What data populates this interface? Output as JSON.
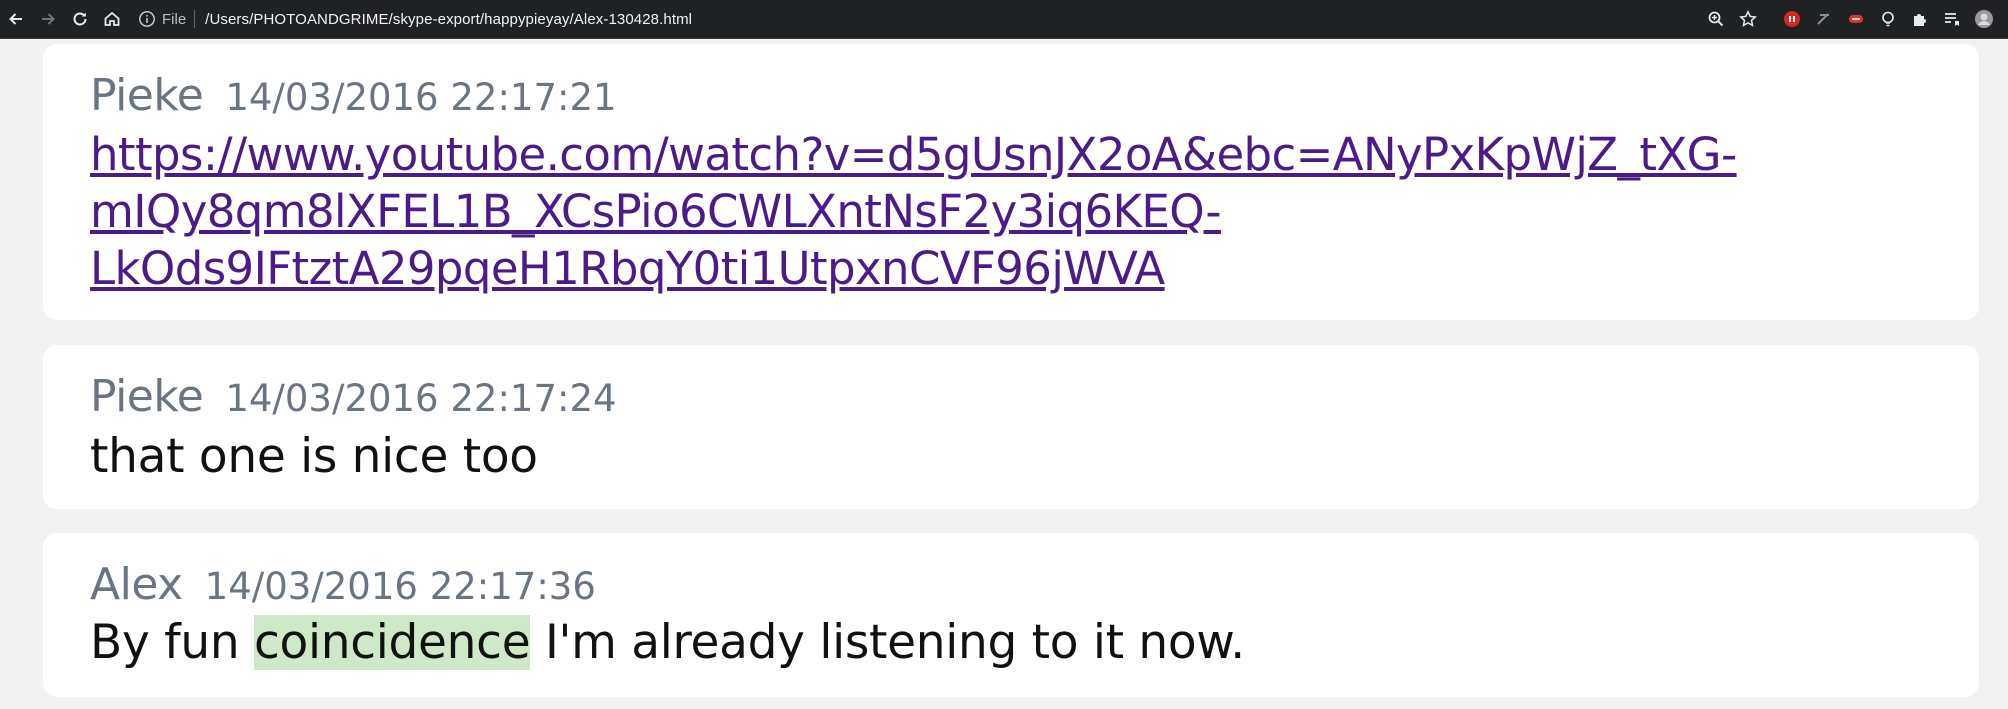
{
  "browser": {
    "url_scheme": "File",
    "url": "/Users/PHOTOANDGRIME/skype-export/happypieyay/Alex-130428.html",
    "icons": [
      "back-icon",
      "forward-icon",
      "reload-icon",
      "home-icon",
      "info-icon",
      "zoom-icon",
      "star-icon",
      "extension-red-icon",
      "extension-pen-icon",
      "extension-red2-icon",
      "lightbulb-icon",
      "puzzle-icon",
      "reading-list-icon",
      "profile-avatar"
    ]
  },
  "messages": [
    {
      "author": "Pieke",
      "timestamp": "14/03/2016 22:17:21",
      "link_lines": [
        "https://www.youtube.com/watch?v=d5gUsnJX2oA&ebc=ANyPxKpWjZ_tXG-",
        "mIQy8qm8lXFEL1B_XCsPio6CWLXntNsF2y3iq6KEQ-",
        "LkOds9IFtztA29pqeH1RbqY0ti1UtpxnCVF96jWVA"
      ]
    },
    {
      "author": "Pieke",
      "timestamp": "14/03/2016 22:17:24",
      "text": "that one is nice too"
    },
    {
      "author": "Alex",
      "timestamp": "14/03/2016 22:17:36",
      "text_before": "By fun ",
      "text_highlight": "coincidence",
      "text_after": " I'm already listening to it now."
    }
  ],
  "colors": {
    "author": "#6a7584",
    "link": "#4b1c87",
    "highlight": "#cfe9c8",
    "page_bg": "#f2f2f2",
    "card_bg": "#ffffff"
  }
}
